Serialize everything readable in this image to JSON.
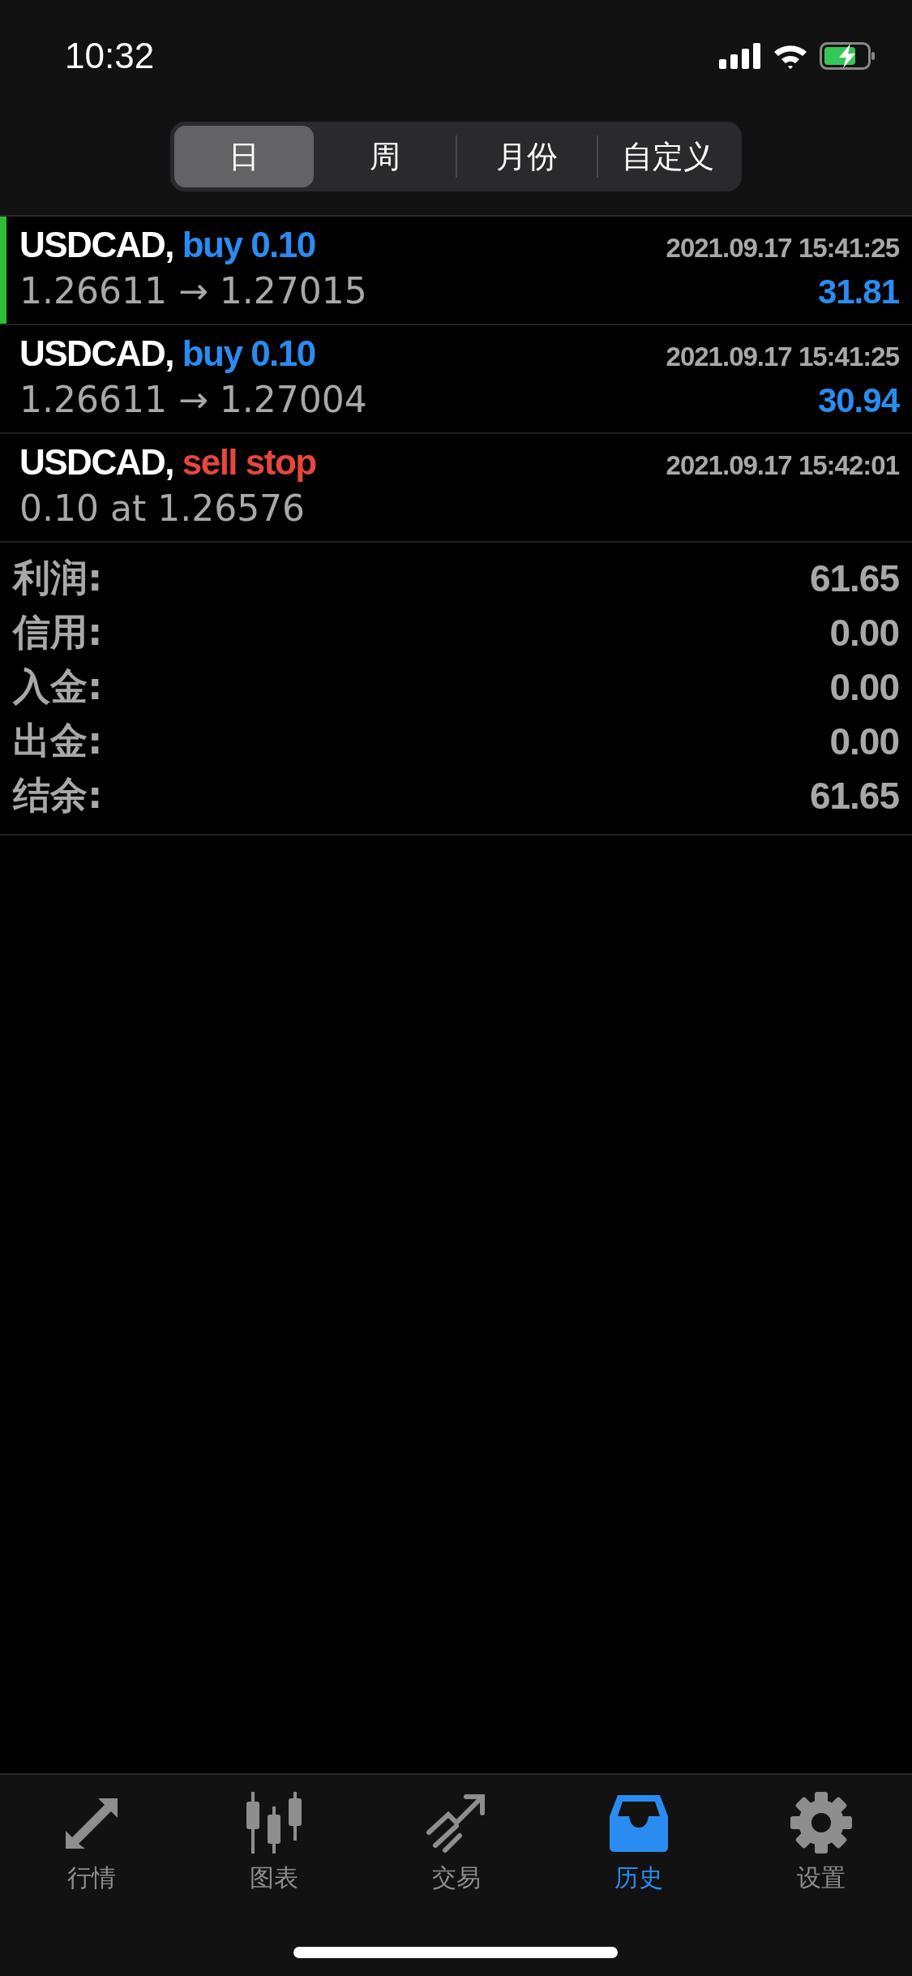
{
  "status_bar": {
    "time": "10:32"
  },
  "segments": [
    {
      "label": "日",
      "selected": true
    },
    {
      "label": "周",
      "selected": false
    },
    {
      "label": "月份",
      "selected": false
    },
    {
      "label": "自定义",
      "selected": false
    }
  ],
  "trades": [
    {
      "symbol": "USDCAD,",
      "side": "buy 0.10",
      "kind": "buy",
      "time": "2021.09.17 15:41:25",
      "detail": "1.26611 → 1.27015",
      "profit": "31.81",
      "selected": true
    },
    {
      "symbol": "USDCAD,",
      "side": "buy 0.10",
      "kind": "buy",
      "time": "2021.09.17 15:41:25",
      "detail": "1.26611 → 1.27004",
      "profit": "30.94",
      "selected": false
    },
    {
      "symbol": "USDCAD,",
      "side": "sell stop",
      "kind": "sell",
      "time": "2021.09.17 15:42:01",
      "detail": "0.10 at 1.26576",
      "selected": false
    }
  ],
  "summary": [
    {
      "label": "利润:",
      "value": "61.65"
    },
    {
      "label": "信用:",
      "value": "0.00"
    },
    {
      "label": "入金:",
      "value": "0.00"
    },
    {
      "label": "出金:",
      "value": "0.00"
    },
    {
      "label": "结余:",
      "value": "61.65"
    }
  ],
  "tab_bar": [
    {
      "label": "行情",
      "selected": false
    },
    {
      "label": "图表",
      "selected": false
    },
    {
      "label": "交易",
      "selected": false
    },
    {
      "label": "历史",
      "selected": true
    },
    {
      "label": "设置",
      "selected": false
    }
  ]
}
